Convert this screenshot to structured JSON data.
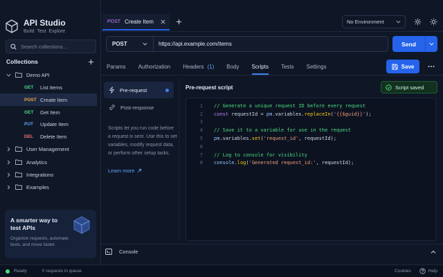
{
  "app": {
    "name": "API Studio",
    "nav": [
      "Build",
      "Test",
      "Explore"
    ]
  },
  "sidebar": {
    "search_placeholder": "Search collections...",
    "collections_label": "Collections",
    "tree": [
      {
        "type": "folder",
        "label": "Demo API",
        "expanded": true
      },
      {
        "type": "request",
        "method": "GET",
        "label": "List Items"
      },
      {
        "type": "request",
        "method": "POST",
        "label": "Create Item",
        "selected": true
      },
      {
        "type": "request",
        "method": "GET",
        "label": "Get Item"
      },
      {
        "type": "request",
        "method": "PUT",
        "label": "Update Item"
      },
      {
        "type": "request",
        "method": "DEL",
        "label": "Delete Item"
      },
      {
        "type": "folder",
        "label": "User Management",
        "expanded": false
      },
      {
        "type": "folder",
        "label": "Analytics",
        "expanded": false
      },
      {
        "type": "folder",
        "label": "Integrations",
        "expanded": false
      },
      {
        "type": "folder",
        "label": "Examples",
        "expanded": false
      }
    ],
    "promo": {
      "title": "A smarter way to test APIs",
      "text": "Organize requests, automate tests, and move faster."
    }
  },
  "tab": {
    "method": "POST",
    "title": "Create Item"
  },
  "environment": "No Environment",
  "request": {
    "method": "POST",
    "url": "https://api.example.com/items",
    "send_label": "Send"
  },
  "subtabs": [
    {
      "label": "Params"
    },
    {
      "label": "Authorization"
    },
    {
      "label": "Headers",
      "badge": "(1)"
    },
    {
      "label": "Body"
    },
    {
      "label": "Scripts",
      "active": true
    },
    {
      "label": "Tests"
    },
    {
      "label": "Settings"
    }
  ],
  "save_label": "Save",
  "scripts": {
    "pre_request": "Pre-request",
    "post_response": "Post-response",
    "description": "Scripts let you run code before a request is sent. Use this to set variables, modify request data, or perform other setup tasks.",
    "learn_more": "Learn more"
  },
  "editor": {
    "title": "Pre-request script",
    "toast": "Script saved",
    "lines": [
      "// Generate a unique request ID before every request",
      "const requestId = pm.variables.replaceIn('{{$guid}}');",
      "",
      "// Save it to a variable for use in the request",
      "pm.variables.set('request_id', requestId);",
      "",
      "// Log to console for visibility",
      "console.log('Generated request_id:', requestId);"
    ]
  },
  "console_label": "Console",
  "status": {
    "state": "Ready",
    "queue": "0 requests in queue",
    "cookies": "Cookies",
    "help": "Help"
  },
  "colors": {
    "accent": "#2563eb",
    "ready": "#4ade80",
    "get": "#4ade80",
    "post": "#f0a14a",
    "put": "#60a5fa",
    "delete": "#f87171"
  }
}
